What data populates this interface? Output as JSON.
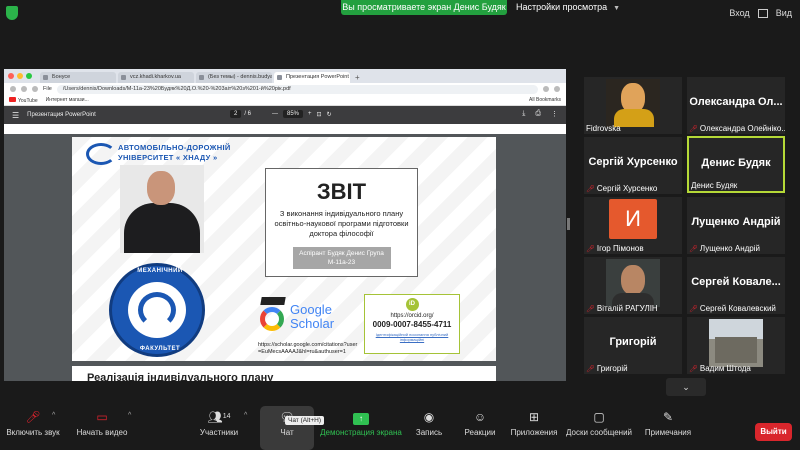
{
  "top": {
    "sharing_banner": "Вы просматриваете экран Денис Будяк",
    "view_settings": "Настройки просмотра",
    "login": "Вход",
    "view": "Вид"
  },
  "browser": {
    "tabs": [
      "Бонусе",
      "vcz.khadi.kharkov.ua",
      "(Без темы) - dennis.budyak@…",
      "Презентация PowerPoint"
    ],
    "address_label": "File",
    "url": "/Users/dennis/Downloads/М-11а-23%20Будяк%20Д.О.%20-%203аіт%20з%201-й%20рік.pdf",
    "bookmarks": [
      "YouTube",
      "Интернет магази..."
    ],
    "all_bookmarks": "All Bookmarks"
  },
  "pdf": {
    "title": "Презентация PowerPoint",
    "page_current": "2",
    "page_total": "/ 6",
    "zoom": "85%"
  },
  "slide": {
    "university_line1": "АВТОМОБІЛЬНО-ДОРОЖНІЙ",
    "university_line2": "УНІВЕРСИТЕТ « ХНАДУ »",
    "emblem_top": "МЕХАНІЧНИЙ",
    "emblem_bottom": "ФАКУЛЬТЕТ",
    "report_title": "ЗВІТ",
    "report_desc": "З виконання індивідуального плану освітньо-наукової програми підготовки доктора філософії",
    "report_author": "Аспірант Будяк Денис Група М-11а-23",
    "gs_word": "Google Scholar",
    "gs_url": "https://scholar.google.com/citations?user=EuMecsAAAAJ&hl=ru&authuser=1",
    "orcid_logo": "iD",
    "orcid_url": "https://orcid.org/",
    "orcid_id": "0009-0007-8455-4711",
    "orcid_small": "Ідентифікаційний посилання публічний інформаційні",
    "next_slide_title": "Реалізація індивідуального плану"
  },
  "participants": [
    {
      "big": "",
      "name": "Fidrovska",
      "muted": false
    },
    {
      "big": "Олександра Ол...",
      "name": "Олександра Олейніко...",
      "muted": true
    },
    {
      "big": "Сергій Хурсенко",
      "name": "Сергій Хурсенко",
      "muted": true
    },
    {
      "big": "Денис Будяк",
      "name": "Денис Будяк",
      "muted": false
    },
    {
      "big": "И",
      "name": "Ігор Пімонов",
      "muted": true
    },
    {
      "big": "Лущенко Андрій",
      "name": "Лущенко Андрій",
      "muted": true
    },
    {
      "big": "",
      "name": "Віталій РАГУЛІН",
      "muted": true
    },
    {
      "big": "Сергей Ковале...",
      "name": "Сергей Ковалевский",
      "muted": true
    },
    {
      "big": "Григорій",
      "name": "Григорій",
      "muted": true
    },
    {
      "big": "",
      "name": "Вадим Штода",
      "muted": true
    }
  ],
  "toolbar": {
    "audio": "Включить звук",
    "video": "Начать видео",
    "participants": "Участники",
    "participants_count": "14",
    "chat": "Чат",
    "chat_tooltip": "Чат (Alt+H)",
    "share": "Демонстрация экрана",
    "record": "Запись",
    "reactions": "Реакции",
    "apps": "Приложения",
    "whiteboards": "Доски сообщений",
    "notes": "Примечания",
    "leave": "Выйти"
  },
  "colors": {
    "accent_green": "#23a03f",
    "leave_red": "#d9262c",
    "uni_blue": "#1b57b3",
    "orcid_green": "#a5c337"
  }
}
